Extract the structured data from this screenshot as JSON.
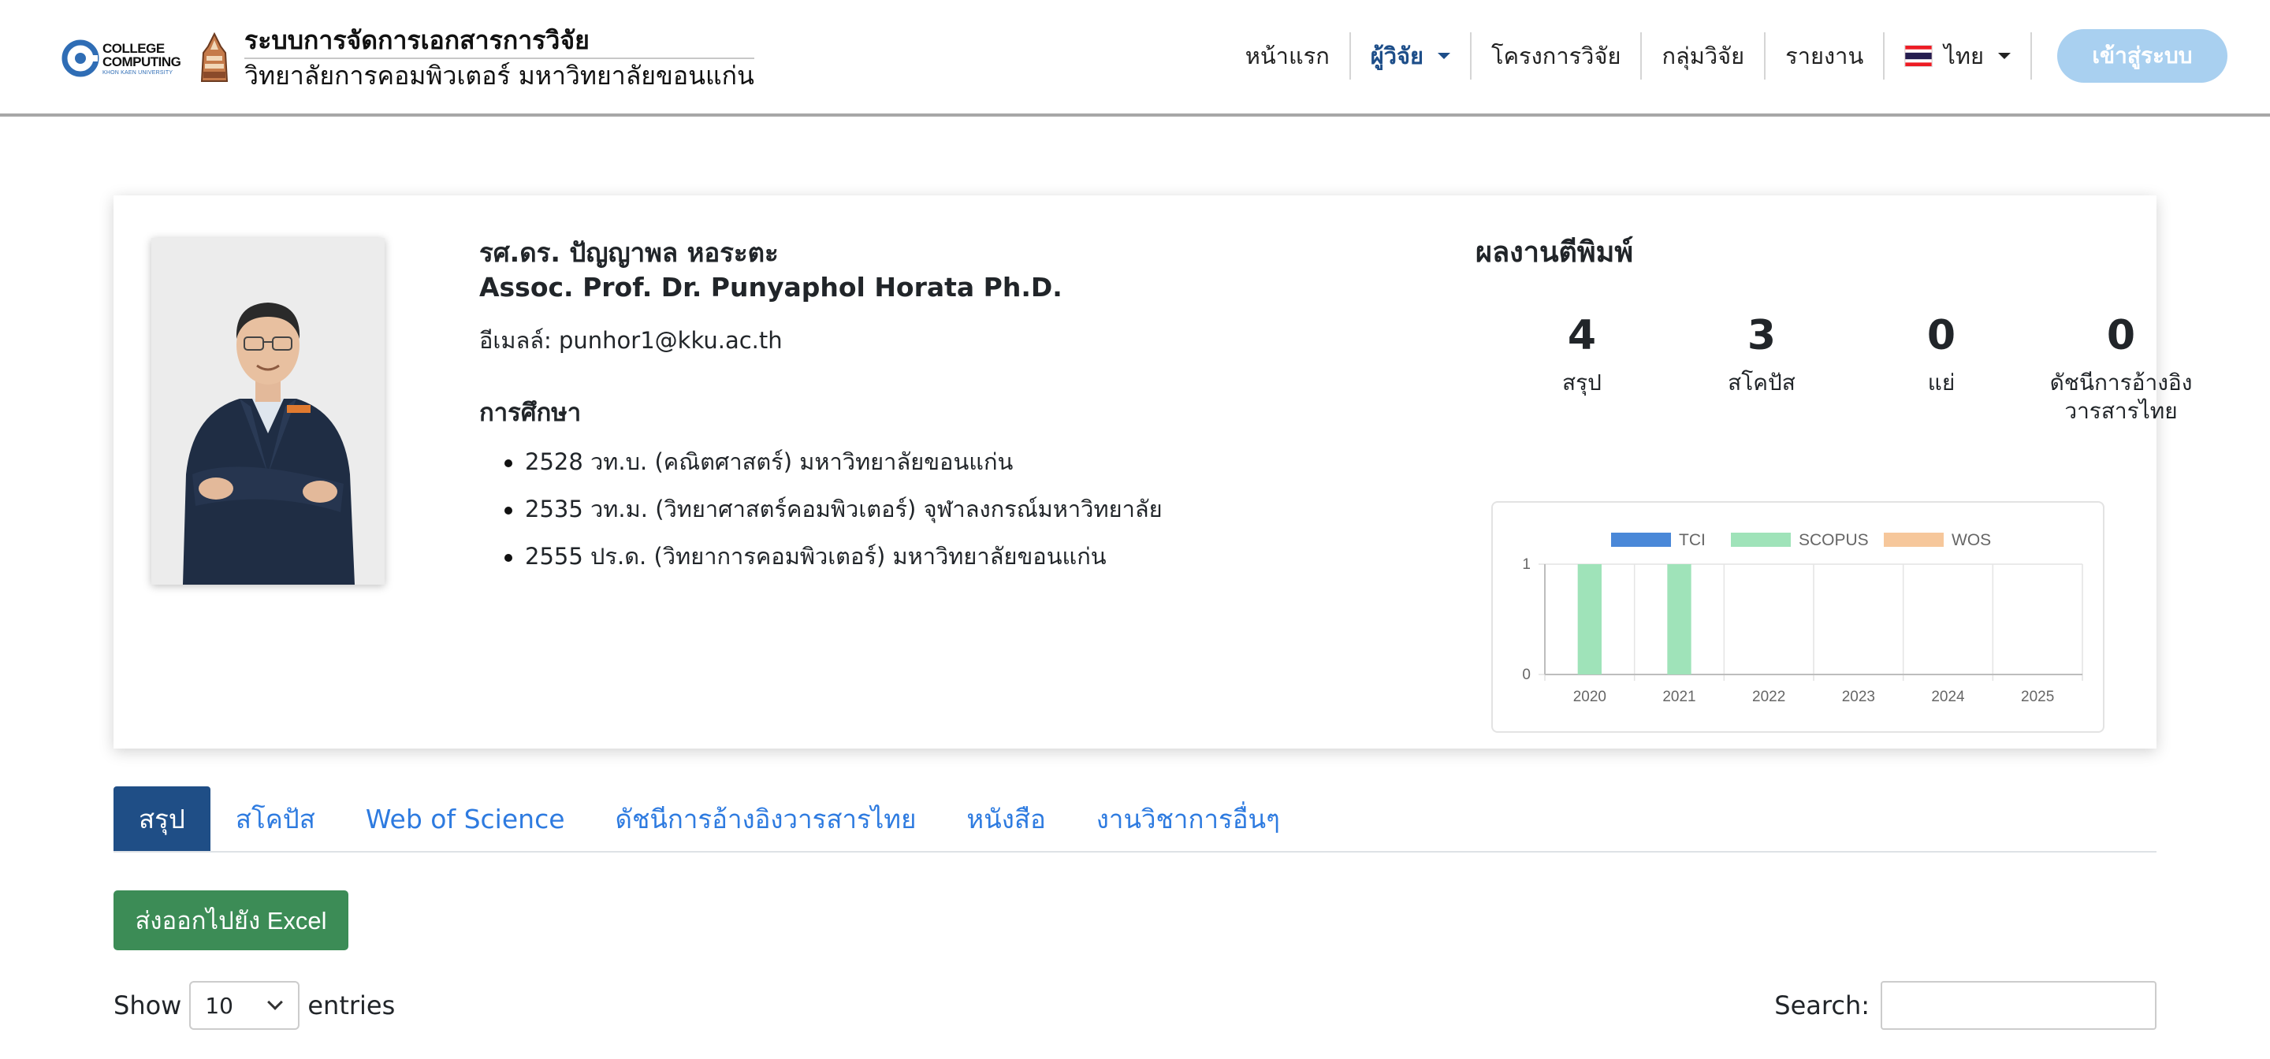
{
  "brand": {
    "college_line1": "COLLEGE",
    "college_line2": "COMPUTING",
    "college_line3": "KHON KAEN UNIVERSITY",
    "title": "ระบบการจัดการเอกสารการวิจัย",
    "subtitle": "วิทยาลัยการคอมพิวเตอร์ มหาวิทยาลัยขอนแก่น"
  },
  "nav": {
    "items": [
      {
        "label": "หน้าแรก"
      },
      {
        "label": "ผู้วิจัย"
      },
      {
        "label": "โครงการวิจัย"
      },
      {
        "label": "กลุ่มวิจัย"
      },
      {
        "label": "รายงาน"
      }
    ],
    "language": "ไทย",
    "login": "เข้าสู่ระบบ",
    "accent": "#1d4e89"
  },
  "profile": {
    "name_th": "รศ.ดร. ปัญญาพล หอระตะ",
    "name_en": "Assoc. Prof. Dr. Punyaphol Horata Ph.D.",
    "email_label": "อีเมลล์:",
    "email": "punhor1@kku.ac.th",
    "education_heading": "การศึกษา",
    "education": [
      "2528 วท.บ. (คณิตศาสตร์) มหาวิทยาลัยขอนแก่น",
      "2535 วท.ม. (วิทยาศาสตร์คอมพิวเตอร์) จุฬาลงกรณ์มหาวิทยาลัย",
      "2555 ปร.ด. (วิทยาการคอมพิวเตอร์) มหาวิทยาลัยขอนแก่น"
    ]
  },
  "publications": {
    "title": "ผลงานตีพิมพ์",
    "stats": [
      {
        "value": "4",
        "label": "สรุป"
      },
      {
        "value": "3",
        "label": "สโคปัส"
      },
      {
        "value": "0",
        "label": "แย่"
      },
      {
        "value": "0",
        "label": "ดัชนีการอ้างอิงวารสารไทย"
      }
    ]
  },
  "chart_data": {
    "type": "bar",
    "categories": [
      "2020",
      "2021",
      "2022",
      "2023",
      "2024",
      "2025"
    ],
    "series": [
      {
        "name": "TCI",
        "values": [
          0,
          0,
          0,
          0,
          0,
          0
        ],
        "color": "#4a88d8"
      },
      {
        "name": "SCOPUS",
        "values": [
          1,
          1,
          0,
          0,
          0,
          0
        ],
        "color": "#9fe3b9"
      },
      {
        "name": "WOS",
        "values": [
          0,
          0,
          0,
          0,
          0,
          0
        ],
        "color": "#f6c79b"
      }
    ],
    "ylim": [
      0,
      1
    ],
    "yticks": [
      "0",
      "1"
    ],
    "grid": true,
    "legend": "top"
  },
  "tabs": [
    {
      "label": "สรุป",
      "active": true
    },
    {
      "label": "สโคปัส"
    },
    {
      "label": "Web of Science"
    },
    {
      "label": "ดัชนีการอ้างอิงวารสารไทย"
    },
    {
      "label": "หนังสือ"
    },
    {
      "label": "งานวิชาการอื่นๆ"
    }
  ],
  "export_button": "ส่งออกไปยัง Excel",
  "table_controls": {
    "show_label": "Show",
    "page_size": "10",
    "entries_label": "entries",
    "search_label": "Search:",
    "search_value": ""
  }
}
